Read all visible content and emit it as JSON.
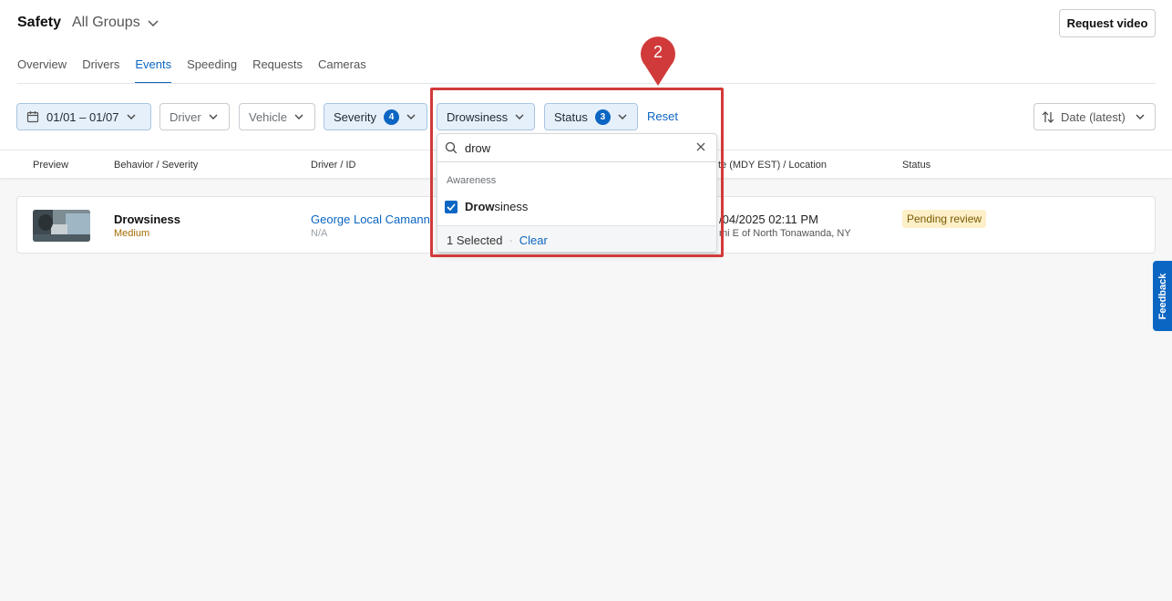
{
  "header": {
    "title": "Safety",
    "group_selector": "All Groups",
    "request_video_label": "Request video"
  },
  "tabs": [
    {
      "label": "Overview",
      "active": false
    },
    {
      "label": "Drivers",
      "active": false
    },
    {
      "label": "Events",
      "active": true
    },
    {
      "label": "Speeding",
      "active": false
    },
    {
      "label": "Requests",
      "active": false
    },
    {
      "label": "Cameras",
      "active": false
    }
  ],
  "filters": {
    "date_range": "01/01 – 01/07",
    "driver": "Driver",
    "vehicle": "Vehicle",
    "severity": {
      "label": "Severity",
      "count": "4"
    },
    "behavior": "Drowsiness",
    "status": {
      "label": "Status",
      "count": "3"
    },
    "reset_label": "Reset"
  },
  "sort": {
    "label": "Date (latest)"
  },
  "table": {
    "columns": [
      "Preview",
      "Behavior / Severity",
      "Driver / ID",
      "te (MDY EST) / Location",
      "Status"
    ],
    "rows": [
      {
        "behavior": "Drowsiness",
        "severity": "Medium",
        "driver": "George Local Camann",
        "driver_id": "N/A",
        "date": "/04/2025 02:11 PM",
        "location": "mi E of North Tonawanda, NY",
        "status": "Pending review"
      }
    ]
  },
  "dropdown": {
    "search_value": "drow",
    "group_label": "Awareness",
    "option": {
      "match": "Drow",
      "rest": "siness",
      "checked": true
    },
    "selected_count": "1 Selected",
    "separator": "·",
    "clear_label": "Clear"
  },
  "annotation": {
    "step_number": "2"
  },
  "feedback_label": "Feedback",
  "colors": {
    "accent": "#0b66c3",
    "highlight": "#d13a3a",
    "pending_bg": "#fdf0c9",
    "severity_medium": "#a36b00"
  }
}
